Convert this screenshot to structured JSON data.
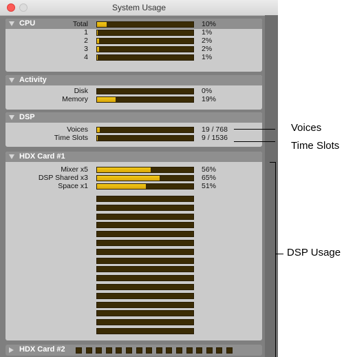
{
  "window": {
    "title": "System Usage"
  },
  "cpu": {
    "header": "CPU",
    "rows": [
      {
        "label": "Total",
        "value": "10%",
        "level": 0.1
      },
      {
        "label": "1",
        "value": "1%",
        "level": 0.01
      },
      {
        "label": "2",
        "value": "2%",
        "level": 0.02
      },
      {
        "label": "3",
        "value": "2%",
        "level": 0.02
      },
      {
        "label": "4",
        "value": "1%",
        "level": 0.01
      }
    ]
  },
  "activity": {
    "header": "Activity",
    "rows": [
      {
        "label": "Disk",
        "value": "0%",
        "level": 0.0
      },
      {
        "label": "Memory",
        "value": "19%",
        "level": 0.19
      }
    ]
  },
  "dsp": {
    "header": "DSP",
    "rows": [
      {
        "label": "Voices",
        "value": "19 / 768",
        "level": 0.025
      },
      {
        "label": "Time Slots",
        "value": "9 / 1536",
        "level": 0.006
      }
    ]
  },
  "hdx1": {
    "header": "HDX Card #1",
    "rows": [
      {
        "label": "Mixer x5",
        "value": "56%",
        "level": 0.56
      },
      {
        "label": "DSP Shared x3",
        "value": "65%",
        "level": 0.65
      },
      {
        "label": "Space x1",
        "value": "51%",
        "level": 0.51
      }
    ],
    "empty_bars": 16
  },
  "hdx2": {
    "header": "HDX Card #2",
    "chip_count": 16
  },
  "callouts": {
    "voices": "Voices",
    "time_slots": "Time Slots",
    "dsp_usage": "DSP Usage"
  },
  "colors": {
    "bar_bg": "#3b2c05",
    "bar_fill": "#e6b511",
    "panel": "#cbcbcb",
    "header": "#8f8f8f"
  }
}
